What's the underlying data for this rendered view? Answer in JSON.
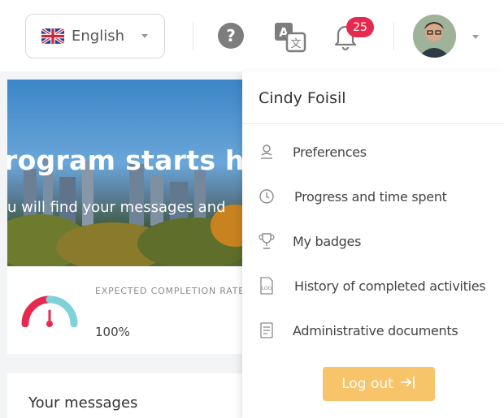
{
  "header": {
    "language": {
      "label": "English",
      "flag": "uk-flag-icon"
    },
    "help_icon": "help-circle-icon",
    "translate_icon": "translate-icon",
    "notifications": {
      "icon": "bell-icon",
      "count": "25"
    },
    "avatar": "user-avatar"
  },
  "hero": {
    "title": "rogram starts he",
    "subtitle": "u will find your messages and"
  },
  "completion": {
    "label": "EXPECTED COMPLETION RATE",
    "value": "100%",
    "gauge_colors": {
      "left": "#e8294f",
      "right": "#7fd3d8"
    }
  },
  "messages": {
    "title": "Your messages"
  },
  "user_menu": {
    "user_name": "Cindy Foisil",
    "items": [
      {
        "label": "Preferences",
        "icon": "user-icon"
      },
      {
        "label": "Progress and time spent",
        "icon": "clock-icon"
      },
      {
        "label": "My badges",
        "icon": "trophy-icon"
      },
      {
        "label": "History of completed activities",
        "icon": "log-file-icon"
      },
      {
        "label": "Administrative documents",
        "icon": "document-icon"
      }
    ],
    "logout_label": "Log out",
    "logout_color": "#f7c46a"
  }
}
